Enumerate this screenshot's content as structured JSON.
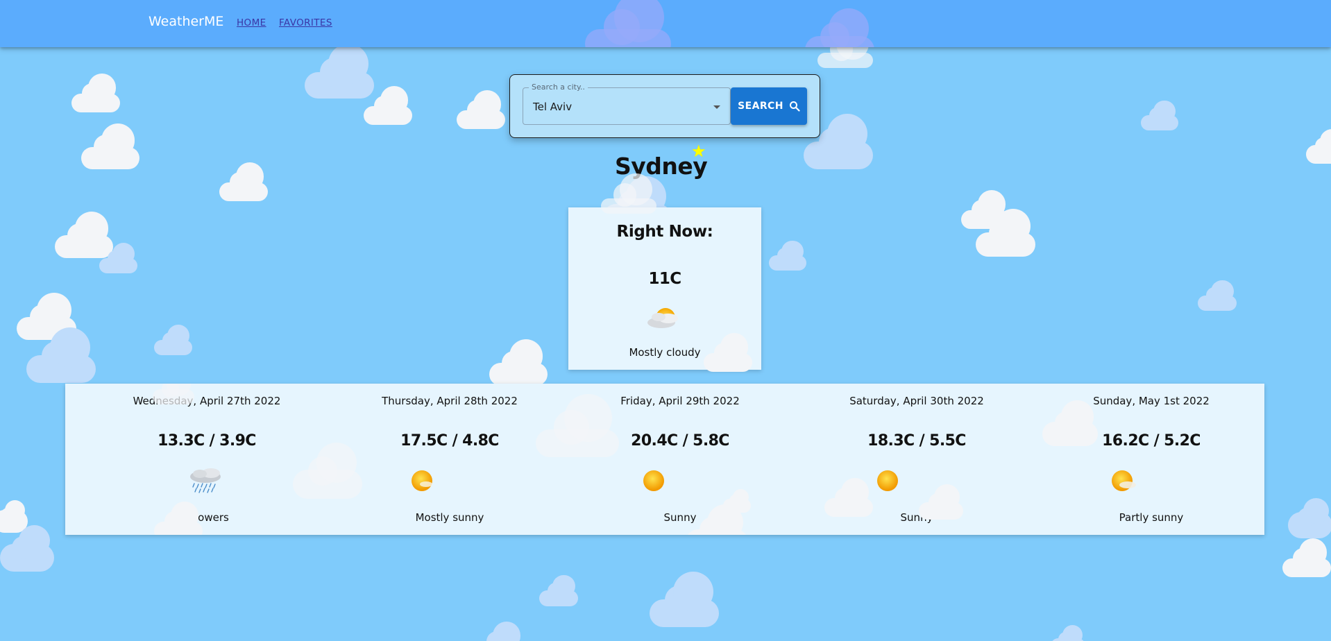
{
  "app": {
    "brand": "WeatherME"
  },
  "nav": {
    "home": "HOME",
    "favorites": "FAVORITES"
  },
  "search": {
    "label": "Search a city..",
    "value": "Tel Aviv",
    "button": "SEARCH",
    "button_icon": "search-icon"
  },
  "city": {
    "name": "Sydney",
    "favorite": true,
    "favorite_icon": "star-icon"
  },
  "current": {
    "heading": "Right Now:",
    "temp": "11C",
    "condition": "Mostly cloudy",
    "icon": "mostly-cloudy-icon"
  },
  "forecast": [
    {
      "date": "Wednesday, April 27th 2022",
      "temp": "13.3C / 3.9C",
      "condition": "Showers",
      "icon": "showers-icon"
    },
    {
      "date": "Thursday, April 28th 2022",
      "temp": "17.5C / 4.8C",
      "condition": "Mostly sunny",
      "icon": "mostly-sunny-icon"
    },
    {
      "date": "Friday, April 29th 2022",
      "temp": "20.4C / 5.8C",
      "condition": "Sunny",
      "icon": "sunny-icon"
    },
    {
      "date": "Saturday, April 30th 2022",
      "temp": "18.3C / 5.5C",
      "condition": "Sunny",
      "icon": "sunny-icon"
    },
    {
      "date": "Sunday, May 1st 2022",
      "temp": "16.2C / 5.2C",
      "condition": "Partly sunny",
      "icon": "partly-sunny-icon"
    }
  ],
  "colors": {
    "background": "#7fcbfb",
    "header": "#5bacfd",
    "card": "#e6f5fe",
    "search_button": "#1976d2",
    "favorite_star": "#ffff00",
    "nav_link": "#3a36a6"
  }
}
